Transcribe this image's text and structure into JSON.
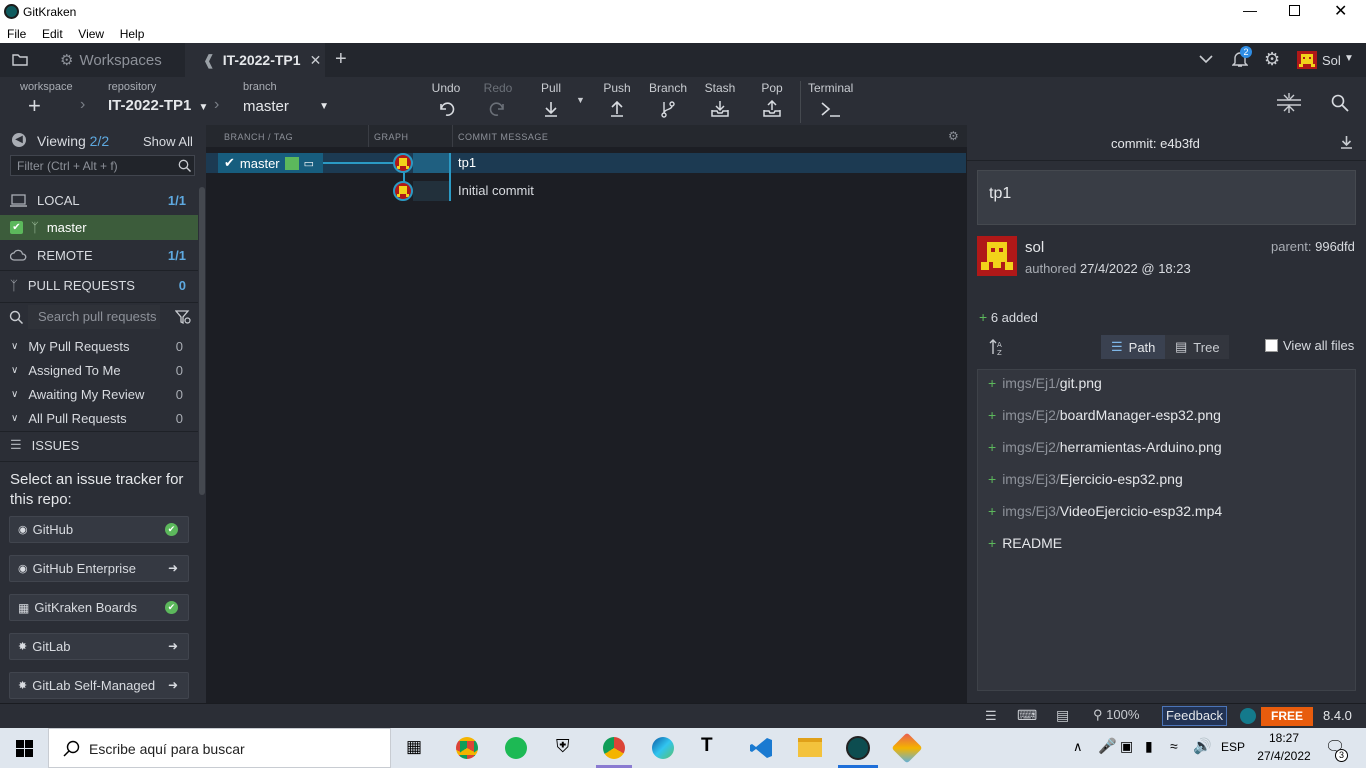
{
  "window": {
    "title": "GitKraken"
  },
  "menu": [
    "File",
    "Edit",
    "View",
    "Help"
  ],
  "tabs": {
    "workspaces": "Workspaces",
    "active": "IT-2022-TP1"
  },
  "header_right": {
    "notifications": "2",
    "user": "Sol"
  },
  "toolbar": {
    "workspace_label": "workspace",
    "repository_label": "repository",
    "repository": "IT-2022-TP1",
    "branch_label": "branch",
    "branch": "master",
    "undo": "Undo",
    "redo": "Redo",
    "pull": "Pull",
    "push": "Push",
    "branch_btn": "Branch",
    "stash": "Stash",
    "pop": "Pop",
    "terminal": "Terminal"
  },
  "left": {
    "viewing": "Viewing",
    "viewing_count": "2/2",
    "show_all": "Show All",
    "filter_placeholder": "Filter (Ctrl + Alt + f)",
    "local": "LOCAL",
    "local_count": "1/1",
    "local_branch": "master",
    "remote": "REMOTE",
    "remote_count": "1/1",
    "pull_requests": "PULL REQUESTS",
    "pull_requests_count": "0",
    "search_pr_placeholder": "Search pull requests",
    "pr_groups": [
      {
        "label": "My Pull Requests",
        "count": "0"
      },
      {
        "label": "Assigned To Me",
        "count": "0"
      },
      {
        "label": "Awaiting My Review",
        "count": "0"
      },
      {
        "label": "All Pull Requests",
        "count": "0"
      }
    ],
    "issues": "ISSUES",
    "issue_prompt": "Select an issue tracker for this repo:",
    "trackers": [
      {
        "label": "GitHub",
        "status": "connected"
      },
      {
        "label": "GitHub Enterprise",
        "status": "login"
      },
      {
        "label": "GitKraken Boards",
        "status": "connected"
      },
      {
        "label": "GitLab",
        "status": "login"
      },
      {
        "label": "GitLab Self-Managed",
        "status": "login"
      }
    ]
  },
  "graph": {
    "col_branch": "BRANCH / TAG",
    "col_graph": "GRAPH",
    "col_message": "COMMIT MESSAGE",
    "branch_label": "master",
    "commits": [
      {
        "message": "tp1"
      },
      {
        "message": "Initial commit"
      }
    ]
  },
  "commit": {
    "label": "commit:",
    "sha": "e4b3fd",
    "message": "tp1",
    "author": "sol",
    "authored_label": "authored",
    "date": "27/4/2022 @ 18:23",
    "parent_label": "parent:",
    "parent": "996dfd",
    "added": "6 added",
    "path_btn": "Path",
    "tree_btn": "Tree",
    "view_all": "View all files",
    "files": [
      {
        "dir": "imgs/Ej1/",
        "name": "git.png"
      },
      {
        "dir": "imgs/Ej2/",
        "name": "boardManager-esp32.png"
      },
      {
        "dir": "imgs/Ej2/",
        "name": "herramientas-Arduino.png"
      },
      {
        "dir": "imgs/Ej3/",
        "name": "Ejercicio-esp32.png"
      },
      {
        "dir": "imgs/Ej3/",
        "name": "VideoEjercicio-esp32.mp4"
      },
      {
        "dir": "",
        "name": "README"
      }
    ]
  },
  "statusbar": {
    "zoom": "100%",
    "feedback": "Feedback",
    "plan": "FREE",
    "version": "8.4.0"
  },
  "taskbar": {
    "search_placeholder": "Escribe aquí para buscar",
    "lang": "ESP",
    "time": "18:27",
    "date": "27/4/2022",
    "notif": "3"
  },
  "colors": {
    "accent_green": "#5cb85c",
    "selected_row": "#1c3a52",
    "master_branch": "#175d7e",
    "free_badge": "#e85c0d"
  }
}
